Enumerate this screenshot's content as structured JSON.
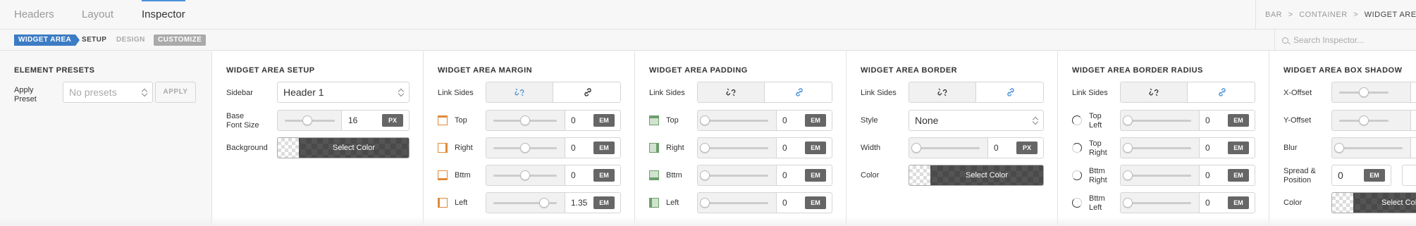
{
  "tabs": [
    {
      "label": "Headers",
      "active": false
    },
    {
      "label": "Layout",
      "active": false
    },
    {
      "label": "Inspector",
      "active": true
    }
  ],
  "breadcrumb": {
    "items": [
      "BAR",
      "CONTAINER",
      "WIDGET AREA"
    ],
    "separator": ">"
  },
  "subnav": {
    "element": "WIDGET AREA",
    "setup": "SETUP",
    "design": "DESIGN",
    "customize": "CUSTOMIZE"
  },
  "search": {
    "placeholder": "Search Inspector..."
  },
  "colors": {
    "accent": "#3c7cc4",
    "unit_badge": "#666666",
    "side_icon_orange": "#e08a3c",
    "side_icon_green": "#6d9e6d"
  },
  "presets": {
    "title": "ELEMENT PRESETS",
    "label": "Apply Preset",
    "select_value": "No presets",
    "apply": "APPLY"
  },
  "setup": {
    "title": "WIDGET AREA SETUP",
    "sidebar_label": "Sidebar",
    "sidebar_value": "Header 1",
    "font_label": "Base Font Size",
    "font_value": "16",
    "font_unit": "PX",
    "font_slider": 0.45,
    "bg_label": "Background",
    "bg_button": "Select Color"
  },
  "margin": {
    "title": "WIDGET AREA MARGIN",
    "link_label": "Link Sides",
    "rows": [
      {
        "label": "Top",
        "value": "0",
        "unit": "EM",
        "slider": 0.5
      },
      {
        "label": "Right",
        "value": "0",
        "unit": "EM",
        "slider": 0.5
      },
      {
        "label": "Bttm",
        "value": "0",
        "unit": "EM",
        "slider": 0.5
      },
      {
        "label": "Left",
        "value": "1.35",
        "unit": "EM",
        "slider": 0.8
      }
    ]
  },
  "padding": {
    "title": "WIDGET AREA PADDING",
    "link_label": "Link Sides",
    "rows": [
      {
        "label": "Top",
        "value": "0",
        "unit": "EM",
        "slider": 0
      },
      {
        "label": "Right",
        "value": "0",
        "unit": "EM",
        "slider": 0
      },
      {
        "label": "Bttm",
        "value": "0",
        "unit": "EM",
        "slider": 0
      },
      {
        "label": "Left",
        "value": "0",
        "unit": "EM",
        "slider": 0
      }
    ]
  },
  "border": {
    "title": "WIDGET AREA BORDER",
    "link_label": "Link Sides",
    "style_label": "Style",
    "style_value": "None",
    "width_label": "Width",
    "width_value": "0",
    "width_unit": "PX",
    "width_slider": 0,
    "color_label": "Color",
    "color_button": "Select Color"
  },
  "radius": {
    "title": "WIDGET AREA BORDER RADIUS",
    "link_label": "Link Sides",
    "rows": [
      {
        "label1": "Top",
        "label2": "Left",
        "value": "0",
        "unit": "EM",
        "slider": 0
      },
      {
        "label1": "Top",
        "label2": "Right",
        "value": "0",
        "unit": "EM",
        "slider": 0
      },
      {
        "label1": "Bttm",
        "label2": "Right",
        "value": "0",
        "unit": "EM",
        "slider": 0
      },
      {
        "label1": "Bttm",
        "label2": "Left",
        "value": "0",
        "unit": "EM",
        "slider": 0
      }
    ]
  },
  "shadow": {
    "title": "WIDGET AREA BOX SHADOW",
    "xoffset_label": "X-Offset",
    "yoffset_label": "Y-Offset",
    "blur_label": "Blur",
    "spread_label": "Spread & Position",
    "spread_value": "0",
    "spread_unit": "EM",
    "color_label": "Color",
    "color_button": "Select Color",
    "x_slider": 0.5,
    "y_slider": 0.5,
    "blur_slider": 0
  }
}
